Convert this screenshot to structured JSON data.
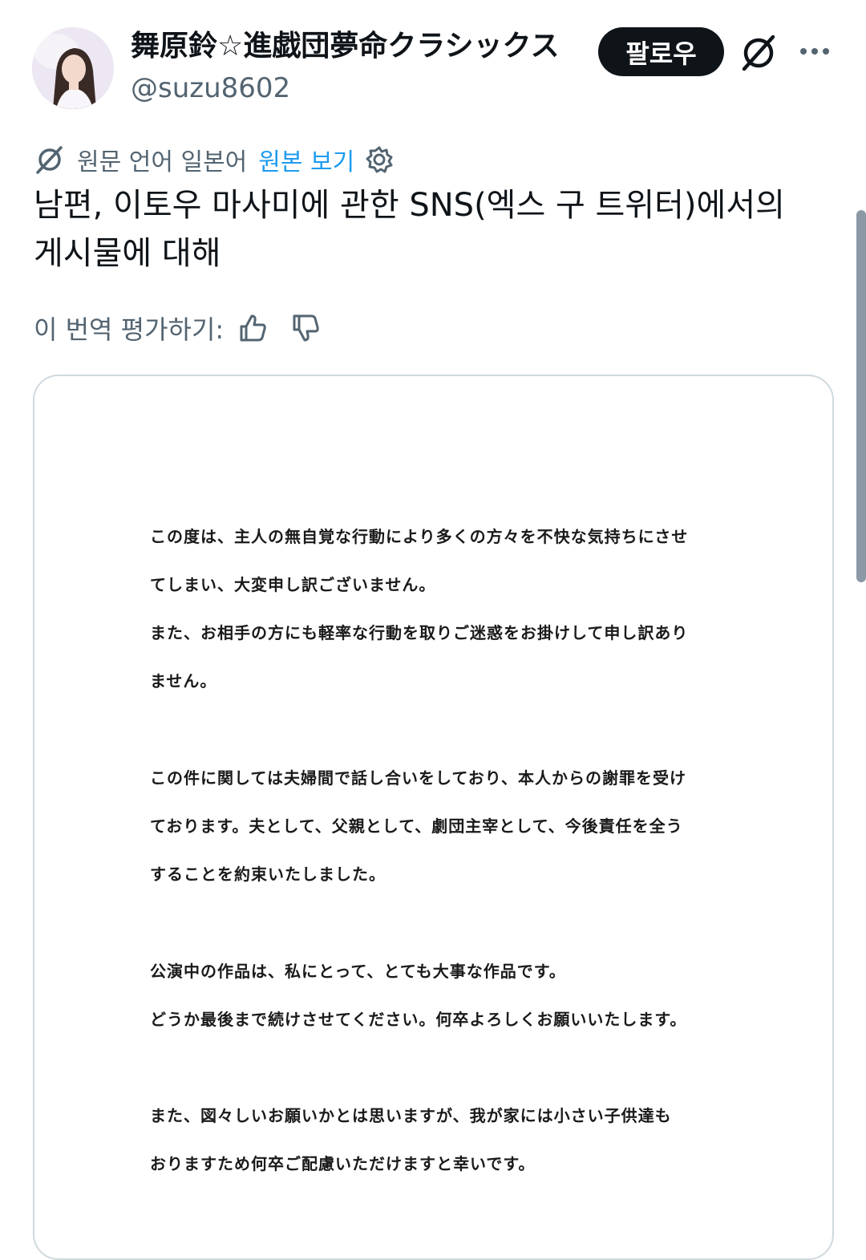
{
  "header": {
    "display_name": "舞原鈴☆進戯団夢命クラシックス",
    "handle": "@suzu8602",
    "follow_label": "팔로우",
    "avatar_icon": "user-avatar-photo",
    "grok_icon": "grok-icon",
    "more_icon": "more-horizontal-icon"
  },
  "translation": {
    "source_language": "원문 언어 일본어",
    "show_original": "원본 보기",
    "settings_icon": "gear-icon",
    "text_line1": "남편, 이토우 마사미에 관한 SNS(엑스 구 트위터)에서의",
    "text_line2": "게시물에 대해",
    "rate_label": "이 번역 평가하기:",
    "thumbs_up_icon": "thumbs-up-icon",
    "thumbs_down_icon": "thumbs-down-icon"
  },
  "document": {
    "lines": [
      " この度は、主人の無自覚な行動により多くの方々を不快な気持ちにさせ",
      "てしまい、大変申し訳ございません。",
      "また、お相手の方にも軽率な行動を取りご迷惑をお掛けして申し訳あり",
      "ません。",
      "この件に関しては夫婦間で話し合いをしており、本人からの謝罪を受け",
      "ております。夫として、父親として、劇団主宰として、今後責任を全う",
      "することを約束いたしました。",
      "公演中の作品は、私にとって、とても大事な作品です。",
      "どうか最後まで続けさせてください。何卒よろしくお願いいたします。",
      "また、図々しいお願いかとは思いますが、我が家には小さい子供達も",
      "おりますため何卒ご配慮いただけますと幸いです。"
    ]
  },
  "colors": {
    "text": "#0f1419",
    "secondary": "#536471",
    "link": "#1d9bf0",
    "border": "#cfd9de"
  }
}
